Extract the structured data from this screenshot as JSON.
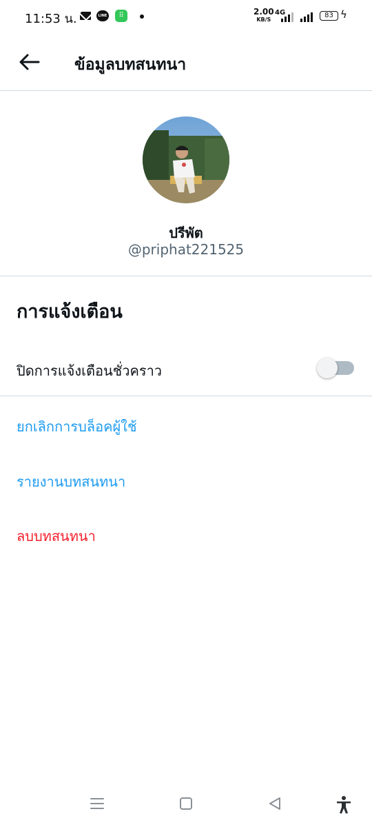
{
  "status_bar": {
    "time": "11:53 น.",
    "net_speed": "2.00",
    "net_unit": "KB/S",
    "net_type": "4G",
    "battery": "83",
    "icons": [
      "mail-icon",
      "line-app-icon",
      "app-notification-icon",
      "dot-icon",
      "signal-icon",
      "battery-icon",
      "charging-icon"
    ]
  },
  "header": {
    "title": "ข้อมูลบทสนทนา",
    "back_icon": "arrow-left-icon"
  },
  "profile": {
    "display_name": "ปรีพัต",
    "handle": "@priphat221525"
  },
  "notifications": {
    "section_title": "การแจ้งเตือน",
    "snooze_label": "ปิดการแจ้งเตือนชั่วคราว",
    "snooze_enabled": false
  },
  "actions": {
    "unblock": "ยกเลิกการบล็อคผู้ใช้",
    "report": "รายงานบทสนทนา",
    "delete": "ลบบทสนทนา"
  },
  "colors": {
    "link_blue": "#1d9bf0",
    "danger_red": "#f4212e",
    "divider": "#cfd9de",
    "secondary_text": "#536471"
  },
  "nav_bar": {
    "icons": [
      "menu-icon",
      "home-square-icon",
      "back-triangle-icon",
      "accessibility-icon"
    ]
  }
}
